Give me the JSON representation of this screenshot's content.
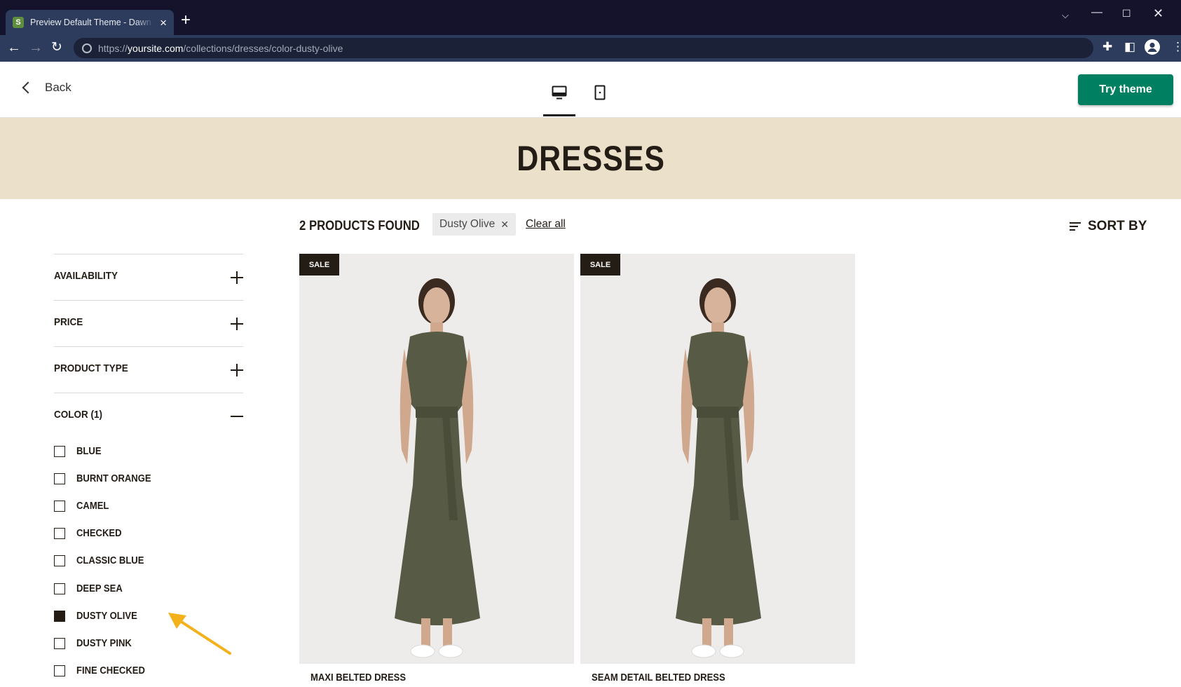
{
  "browser": {
    "tab_title": "Preview Default Theme - Dawn Edition",
    "tab_favicon": "S",
    "url_scheme": "https://",
    "url_domain": "yoursite.com",
    "url_path": "/collections/dresses/color-dusty-olive"
  },
  "preview_header": {
    "back_label": "Back",
    "try_theme_label": "Try theme",
    "devices": [
      "desktop-icon",
      "mobile-icon"
    ],
    "active_device": "desktop",
    "accent_color": "#008060"
  },
  "collection": {
    "title": "DRESSES",
    "banner_color": "#ebe1ca"
  },
  "results": {
    "count_label": "2 PRODUCTS FOUND",
    "active_filter": "Dusty Olive",
    "clear_all_label": "Clear all",
    "sort_label": "SORT BY"
  },
  "filters": {
    "groups": [
      {
        "label": "AVAILABILITY",
        "expanded": false
      },
      {
        "label": "PRICE",
        "expanded": false
      },
      {
        "label": "PRODUCT TYPE",
        "expanded": false
      },
      {
        "label": "COLOR (1)",
        "expanded": true
      }
    ],
    "color_options": [
      {
        "label": "BLUE",
        "checked": false
      },
      {
        "label": "BURNT ORANGE",
        "checked": false
      },
      {
        "label": "CAMEL",
        "checked": false
      },
      {
        "label": "CHECKED",
        "checked": false
      },
      {
        "label": "CLASSIC BLUE",
        "checked": false
      },
      {
        "label": "DEEP SEA",
        "checked": false
      },
      {
        "label": "DUSTY OLIVE",
        "checked": true
      },
      {
        "label": "DUSTY PINK",
        "checked": false
      },
      {
        "label": "FINE CHECKED",
        "checked": false
      }
    ]
  },
  "products": [
    {
      "name": "MAXI BELTED DRESS",
      "badge": "SALE",
      "dress_color": "#575a45"
    },
    {
      "name": "SEAM DETAIL BELTED DRESS",
      "badge": "SALE",
      "dress_color": "#575a45"
    }
  ],
  "annotation": {
    "arrow_color": "#f3b21b"
  }
}
